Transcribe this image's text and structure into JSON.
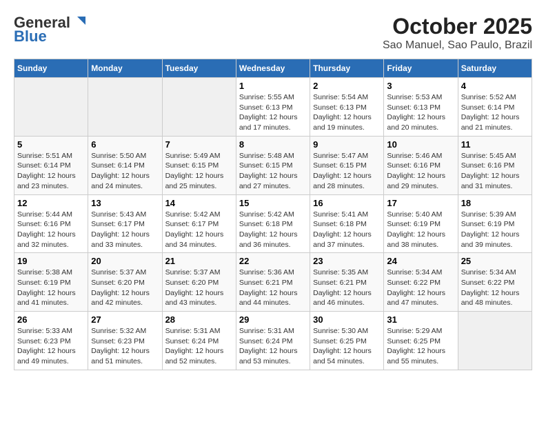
{
  "logo": {
    "line1": "General",
    "line2": "Blue"
  },
  "title": "October 2025",
  "subtitle": "Sao Manuel, Sao Paulo, Brazil",
  "days_of_week": [
    "Sunday",
    "Monday",
    "Tuesday",
    "Wednesday",
    "Thursday",
    "Friday",
    "Saturday"
  ],
  "weeks": [
    [
      {
        "day": "",
        "info": ""
      },
      {
        "day": "",
        "info": ""
      },
      {
        "day": "",
        "info": ""
      },
      {
        "day": "1",
        "info": "Sunrise: 5:55 AM\nSunset: 6:13 PM\nDaylight: 12 hours and 17 minutes."
      },
      {
        "day": "2",
        "info": "Sunrise: 5:54 AM\nSunset: 6:13 PM\nDaylight: 12 hours and 19 minutes."
      },
      {
        "day": "3",
        "info": "Sunrise: 5:53 AM\nSunset: 6:13 PM\nDaylight: 12 hours and 20 minutes."
      },
      {
        "day": "4",
        "info": "Sunrise: 5:52 AM\nSunset: 6:14 PM\nDaylight: 12 hours and 21 minutes."
      }
    ],
    [
      {
        "day": "5",
        "info": "Sunrise: 5:51 AM\nSunset: 6:14 PM\nDaylight: 12 hours and 23 minutes."
      },
      {
        "day": "6",
        "info": "Sunrise: 5:50 AM\nSunset: 6:14 PM\nDaylight: 12 hours and 24 minutes."
      },
      {
        "day": "7",
        "info": "Sunrise: 5:49 AM\nSunset: 6:15 PM\nDaylight: 12 hours and 25 minutes."
      },
      {
        "day": "8",
        "info": "Sunrise: 5:48 AM\nSunset: 6:15 PM\nDaylight: 12 hours and 27 minutes."
      },
      {
        "day": "9",
        "info": "Sunrise: 5:47 AM\nSunset: 6:15 PM\nDaylight: 12 hours and 28 minutes."
      },
      {
        "day": "10",
        "info": "Sunrise: 5:46 AM\nSunset: 6:16 PM\nDaylight: 12 hours and 29 minutes."
      },
      {
        "day": "11",
        "info": "Sunrise: 5:45 AM\nSunset: 6:16 PM\nDaylight: 12 hours and 31 minutes."
      }
    ],
    [
      {
        "day": "12",
        "info": "Sunrise: 5:44 AM\nSunset: 6:16 PM\nDaylight: 12 hours and 32 minutes."
      },
      {
        "day": "13",
        "info": "Sunrise: 5:43 AM\nSunset: 6:17 PM\nDaylight: 12 hours and 33 minutes."
      },
      {
        "day": "14",
        "info": "Sunrise: 5:42 AM\nSunset: 6:17 PM\nDaylight: 12 hours and 34 minutes."
      },
      {
        "day": "15",
        "info": "Sunrise: 5:42 AM\nSunset: 6:18 PM\nDaylight: 12 hours and 36 minutes."
      },
      {
        "day": "16",
        "info": "Sunrise: 5:41 AM\nSunset: 6:18 PM\nDaylight: 12 hours and 37 minutes."
      },
      {
        "day": "17",
        "info": "Sunrise: 5:40 AM\nSunset: 6:19 PM\nDaylight: 12 hours and 38 minutes."
      },
      {
        "day": "18",
        "info": "Sunrise: 5:39 AM\nSunset: 6:19 PM\nDaylight: 12 hours and 39 minutes."
      }
    ],
    [
      {
        "day": "19",
        "info": "Sunrise: 5:38 AM\nSunset: 6:19 PM\nDaylight: 12 hours and 41 minutes."
      },
      {
        "day": "20",
        "info": "Sunrise: 5:37 AM\nSunset: 6:20 PM\nDaylight: 12 hours and 42 minutes."
      },
      {
        "day": "21",
        "info": "Sunrise: 5:37 AM\nSunset: 6:20 PM\nDaylight: 12 hours and 43 minutes."
      },
      {
        "day": "22",
        "info": "Sunrise: 5:36 AM\nSunset: 6:21 PM\nDaylight: 12 hours and 44 minutes."
      },
      {
        "day": "23",
        "info": "Sunrise: 5:35 AM\nSunset: 6:21 PM\nDaylight: 12 hours and 46 minutes."
      },
      {
        "day": "24",
        "info": "Sunrise: 5:34 AM\nSunset: 6:22 PM\nDaylight: 12 hours and 47 minutes."
      },
      {
        "day": "25",
        "info": "Sunrise: 5:34 AM\nSunset: 6:22 PM\nDaylight: 12 hours and 48 minutes."
      }
    ],
    [
      {
        "day": "26",
        "info": "Sunrise: 5:33 AM\nSunset: 6:23 PM\nDaylight: 12 hours and 49 minutes."
      },
      {
        "day": "27",
        "info": "Sunrise: 5:32 AM\nSunset: 6:23 PM\nDaylight: 12 hours and 51 minutes."
      },
      {
        "day": "28",
        "info": "Sunrise: 5:31 AM\nSunset: 6:24 PM\nDaylight: 12 hours and 52 minutes."
      },
      {
        "day": "29",
        "info": "Sunrise: 5:31 AM\nSunset: 6:24 PM\nDaylight: 12 hours and 53 minutes."
      },
      {
        "day": "30",
        "info": "Sunrise: 5:30 AM\nSunset: 6:25 PM\nDaylight: 12 hours and 54 minutes."
      },
      {
        "day": "31",
        "info": "Sunrise: 5:29 AM\nSunset: 6:25 PM\nDaylight: 12 hours and 55 minutes."
      },
      {
        "day": "",
        "info": ""
      }
    ]
  ]
}
